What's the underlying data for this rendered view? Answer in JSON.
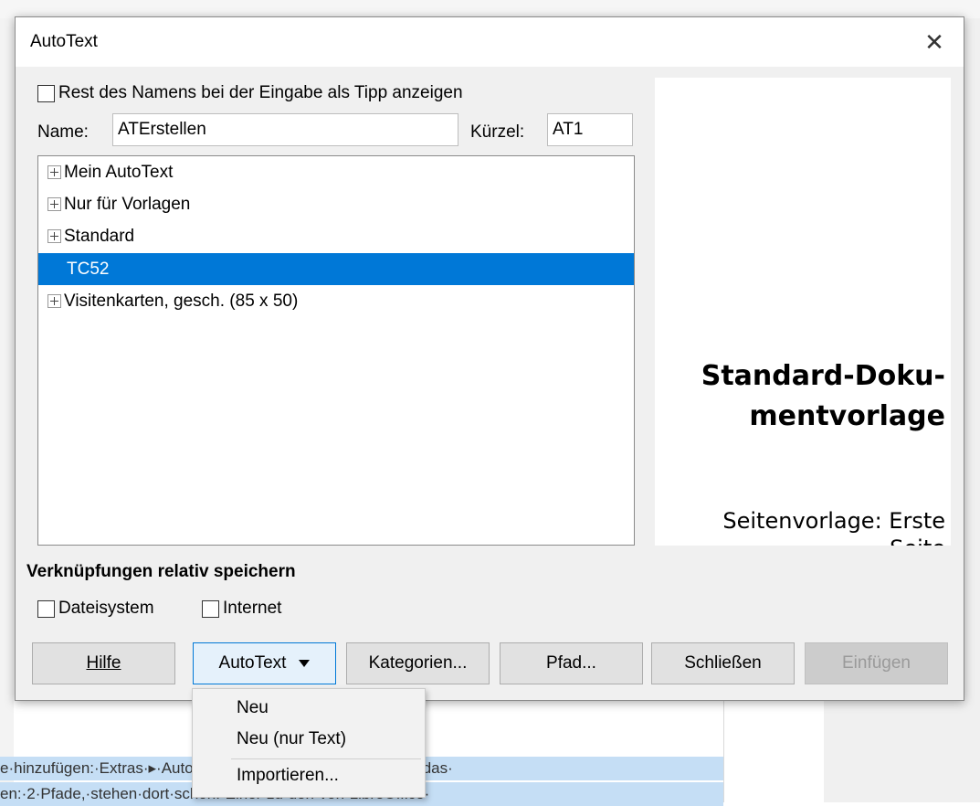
{
  "background": {
    "text_line1": "e·hinzufügen:·Extras·▸·AutoText·…·wählen,·dann·öffnet·sich·das·",
    "text_line2": "en:·2·Pfade,·stehen·dort·schon.·Einer·zu·den·von·LibreOffice·"
  },
  "dialog": {
    "title": "AutoText",
    "close_glyph": "✕",
    "show_tip": {
      "label": "Rest des Namens bei der Eingabe als Tipp anzeigen",
      "checked": false
    },
    "name_label": "Name:",
    "name_value": "ATErstellen",
    "shortcut_label": "Kürzel:",
    "shortcut_value": "AT1",
    "categories": [
      {
        "label": "Mein AutoText",
        "expandable": true,
        "selected": false
      },
      {
        "label": "Nur für Vorlagen",
        "expandable": true,
        "selected": false
      },
      {
        "label": "Standard",
        "expandable": true,
        "selected": false
      },
      {
        "label": "TC52",
        "expandable": false,
        "selected": true
      },
      {
        "label": "Visitenkarten, gesch. (85 x 50)",
        "expandable": true,
        "selected": false
      }
    ],
    "preview": {
      "title_line1": "Standard-Doku-",
      "title_line2": "mentvorlage",
      "sub_line1": "Seitenvorlage: Erste",
      "sub_line2": "Seite"
    },
    "relative_heading": "Verknüpfungen relativ speichern",
    "filesystem": {
      "label": "Dateisystem",
      "checked": false
    },
    "internet": {
      "label": "Internet",
      "checked": false
    },
    "buttons": {
      "help": "Hilfe",
      "autotext": "AutoText",
      "categories": "Kategorien...",
      "path": "Pfad...",
      "close": "Schließen",
      "insert": "Einfügen"
    }
  },
  "menu": {
    "items": [
      "Neu",
      "Neu (nur Text)",
      "Importieren..."
    ]
  },
  "colors": {
    "selection": "#0078d7",
    "dialog_bg": "#f0f0f0",
    "highlight": "#c5def5"
  }
}
